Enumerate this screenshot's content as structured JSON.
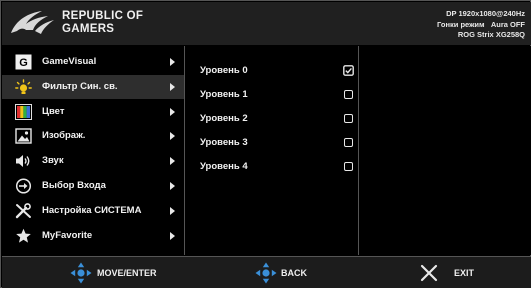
{
  "header": {
    "brand_line1": "REPUBLIC OF",
    "brand_line2": "GAMERS",
    "status_line1": "DP 1920x1080@240Hz",
    "status_line2": "Гонки режим   Aura OFF",
    "status_line3": "ROG Strix XG258Q"
  },
  "menu": {
    "items": [
      {
        "label": "GameVisual",
        "icon": "gamevisual-icon"
      },
      {
        "label": "Фильтр Син. св.",
        "icon": "blue-light-filter-icon"
      },
      {
        "label": "Цвет",
        "icon": "color-icon"
      },
      {
        "label": "Изображ.",
        "icon": "image-icon"
      },
      {
        "label": "Звук",
        "icon": "sound-icon"
      },
      {
        "label": "Выбор Входа",
        "icon": "input-select-icon"
      },
      {
        "label": "Настройка СИСТЕМА",
        "icon": "system-setup-icon"
      },
      {
        "label": "MyFavorite",
        "icon": "favorite-star-icon"
      }
    ],
    "selected_index": 1
  },
  "submenu": {
    "items": [
      {
        "label": "Уровень 0",
        "checked": true
      },
      {
        "label": "Уровень 1",
        "checked": false
      },
      {
        "label": "Уровень 2",
        "checked": false
      },
      {
        "label": "Уровень 3",
        "checked": false
      },
      {
        "label": "Уровень 4",
        "checked": false
      }
    ]
  },
  "footer": {
    "move_enter_label": "MOVE/ENTER",
    "back_label": "BACK",
    "exit_label": "EXIT"
  },
  "colors": {
    "background": "#000000",
    "header_bg": "#202020",
    "selected_bg": "#2e2e2e",
    "footer_bg": "#1c1c1c",
    "accent_blue": "#3a8fd8",
    "text": "#f2f2f2"
  }
}
